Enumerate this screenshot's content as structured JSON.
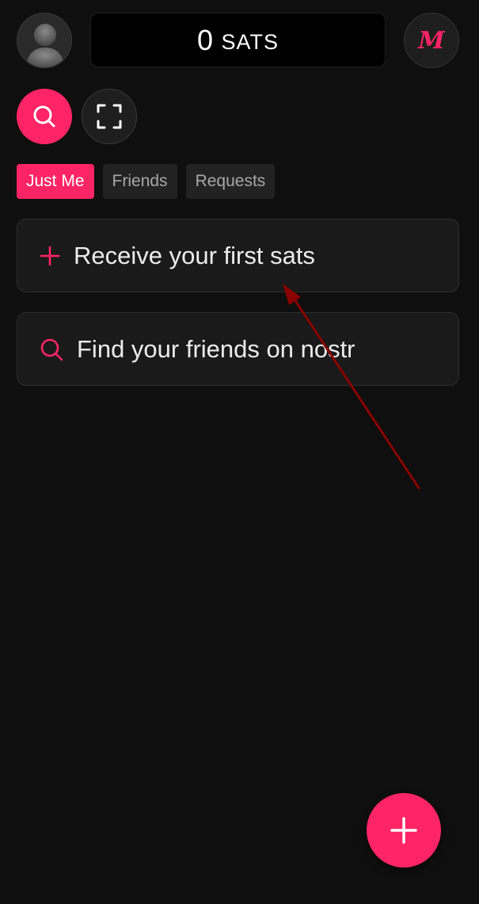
{
  "header": {
    "balance_amount": "0",
    "balance_unit": "SATS",
    "logo_letter": "M"
  },
  "tabs": [
    {
      "label": "Just Me",
      "active": true
    },
    {
      "label": "Friends",
      "active": false
    },
    {
      "label": "Requests",
      "active": false
    }
  ],
  "cards": {
    "receive": {
      "label": "Receive your first sats",
      "icon": "plus-icon"
    },
    "find": {
      "label": "Find your friends on nostr",
      "icon": "search-icon"
    }
  },
  "colors": {
    "accent": "#ff2465",
    "background": "#0f0f0f",
    "card": "#1a1a1a",
    "annotation_arrow": "#8b0000"
  }
}
